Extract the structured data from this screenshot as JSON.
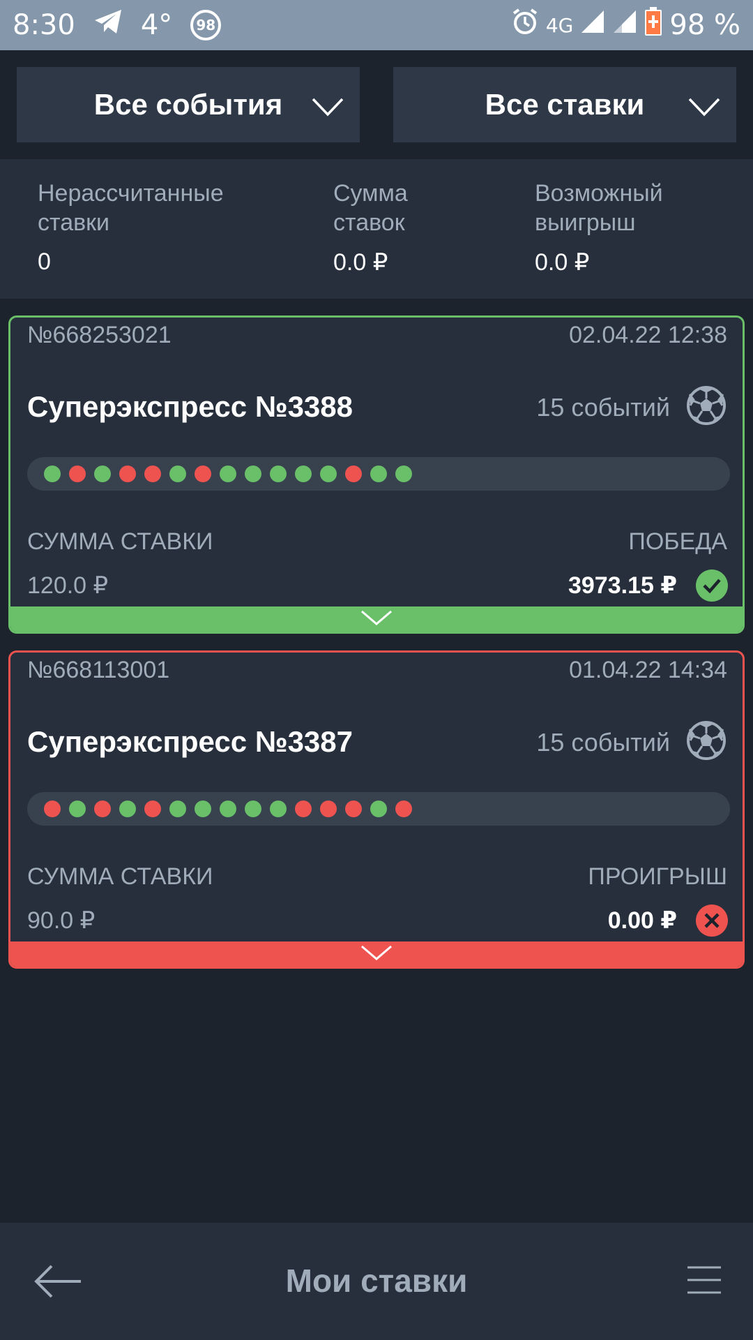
{
  "status_bar": {
    "time": "8:30",
    "temperature": "4°",
    "badge": "98",
    "network": "4G",
    "battery": "98 %"
  },
  "filters": {
    "events_label": "Все события",
    "bets_label": "Все ставки"
  },
  "summary": {
    "unsettled_label": "Нерассчитанные\nставки",
    "unsettled_value": "0",
    "sum_label": "Сумма\nставок",
    "sum_value": "0.0 ₽",
    "possible_win_label": "Возможный\nвыигрыш",
    "possible_win_value": "0.0 ₽"
  },
  "bets": [
    {
      "number": "№668253021",
      "date": "02.04.22 12:38",
      "title": "Суперэкспресс №3388",
      "events": "15 событий",
      "results": [
        "win",
        "loss",
        "win",
        "loss",
        "loss",
        "win",
        "loss",
        "win",
        "win",
        "win",
        "win",
        "win",
        "loss",
        "win",
        "win"
      ],
      "stake_label": "СУММА СТАВКИ",
      "stake_value": "120.0 ₽",
      "outcome_label": "ПОБЕДА",
      "payout_value": "3973.15 ₽",
      "status": "win",
      "status_icon": "check-circle-icon"
    },
    {
      "number": "№668113001",
      "date": "01.04.22 14:34",
      "title": "Суперэкспресс №3387",
      "events": "15 событий",
      "results": [
        "loss",
        "win",
        "loss",
        "win",
        "loss",
        "win",
        "win",
        "win",
        "win",
        "win",
        "loss",
        "loss",
        "loss",
        "win",
        "loss"
      ],
      "stake_label": "СУММА СТАВКИ",
      "stake_value": "90.0 ₽",
      "outcome_label": "ПРОИГРЫШ",
      "payout_value": "0.00 ₽",
      "status": "loss",
      "status_icon": "cross-circle-icon"
    }
  ],
  "colors": {
    "win": "#6abf69",
    "loss": "#ef5350",
    "background": "#1d232c",
    "panel": "#262f3b"
  },
  "bottom_bar": {
    "title": "Мои ставки"
  }
}
